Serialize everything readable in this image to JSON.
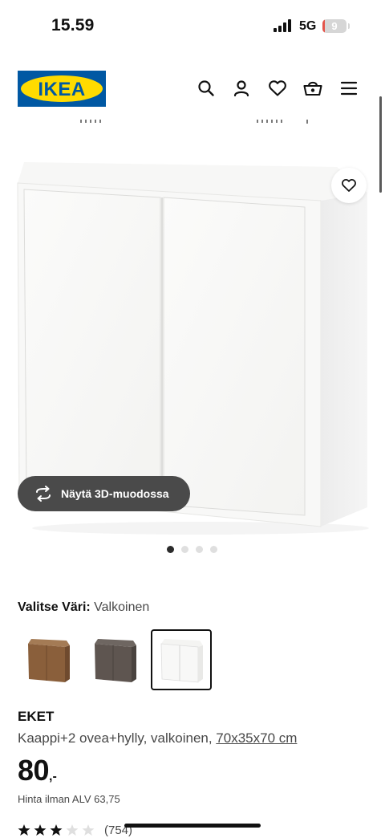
{
  "status_bar": {
    "time": "15.59",
    "network": "5G",
    "battery": "9",
    "battery_level_percent": 9
  },
  "header": {
    "logo_text": "IKEA",
    "brand_colors": {
      "blue": "#0058A3",
      "yellow": "#FFDB00"
    },
    "icons": [
      "search-icon",
      "user-icon",
      "heart-icon",
      "basket-icon",
      "menu-icon"
    ]
  },
  "gallery": {
    "view_3d_label": "Näytä 3D-muodossa",
    "image_count": 4,
    "active_index": 0
  },
  "color_selector": {
    "label": "Valitse Väri:",
    "selected_value": "Valkoinen",
    "swatches": [
      {
        "color": "#8a5f3b",
        "selected": false
      },
      {
        "color": "#5e5550",
        "selected": false
      },
      {
        "color": "#f6f6f3",
        "selected": true
      }
    ]
  },
  "product": {
    "name": "EKET",
    "description": "Kaappi+2 ovea+hylly, valkoinen, ",
    "size": "70x35x70 cm",
    "price": "80",
    "price_suffix": ",-",
    "price_ex_vat": "Hinta ilman ALV 63,75",
    "rating": 3,
    "rating_max": 5,
    "review_count": "(754)"
  }
}
